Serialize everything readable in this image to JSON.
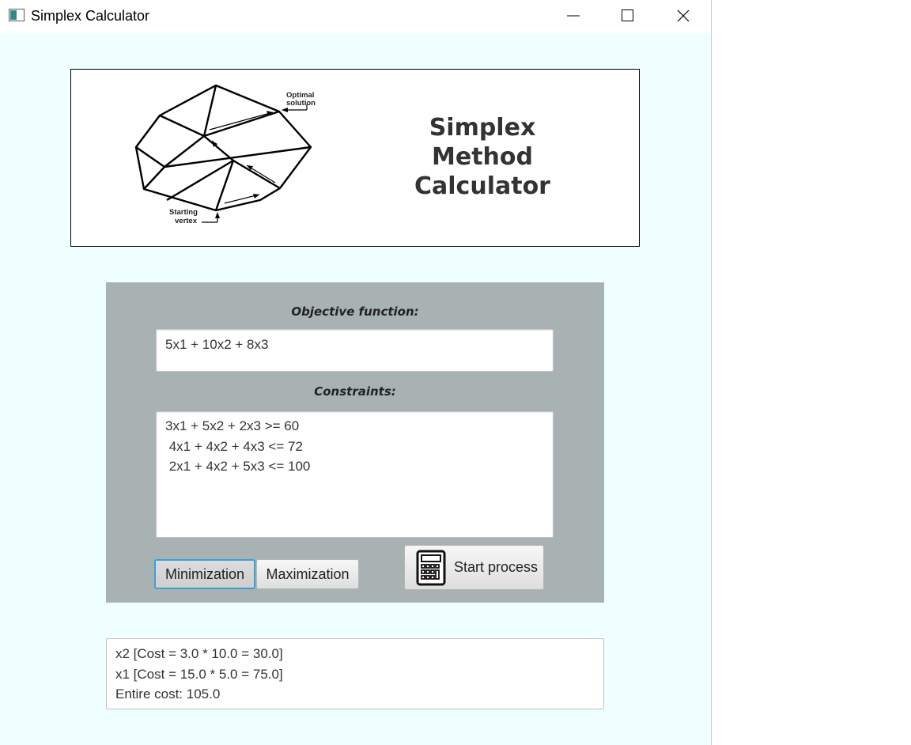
{
  "window": {
    "title": "Simplex Calculator",
    "icons": {
      "app": "app-window-icon",
      "minimize": "minimize-icon",
      "maximize": "maximize-icon",
      "close": "close-icon"
    }
  },
  "banner": {
    "title_lines": [
      "Simplex",
      "Method",
      "Calculator"
    ],
    "diagram_labels": {
      "optimal_1": "Optimal",
      "optimal_2": "solution",
      "start_1": "Starting",
      "start_2": "vertex"
    }
  },
  "form": {
    "objective_label": "Objective function:",
    "objective_value": "5x1 + 10x2 + 8x3",
    "constraints_label": "Constraints:",
    "constraints_lines": [
      "3x1 + 5x2 + 2x3 >= 60",
      " 4x1 + 4x2 + 4x3 <= 72",
      " 2x1 + 4x2 + 5x3 <= 100"
    ],
    "minimization_label": "Minimization",
    "maximization_label": "Maximization",
    "start_label": "Start process",
    "start_icon": "calculator-icon",
    "selected_mode": "Minimization"
  },
  "result": {
    "lines": [
      "x2 [Cost = 3.0 * 10.0 = 30.0]",
      "x1 [Cost = 15.0 * 5.0 = 75.0]",
      "Entire cost: 105.0"
    ]
  }
}
